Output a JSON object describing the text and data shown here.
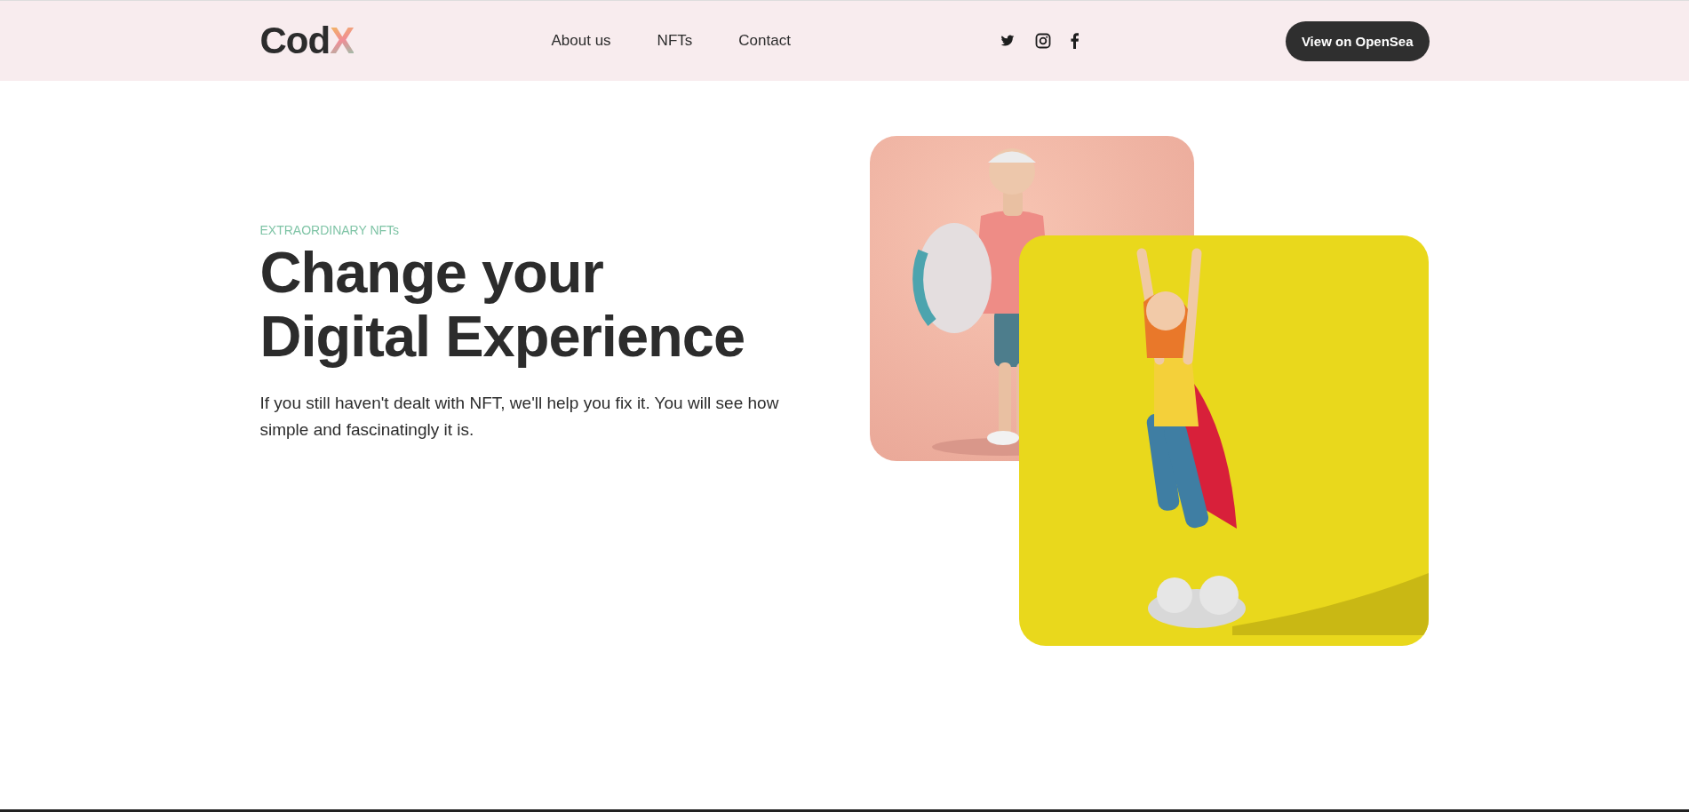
{
  "header": {
    "logo": {
      "main": "Cod",
      "accent": "X"
    },
    "nav": [
      {
        "label": "About us"
      },
      {
        "label": "NFTs"
      },
      {
        "label": "Contact"
      }
    ],
    "cta": "View on OpenSea"
  },
  "hero": {
    "eyebrow": "EXTRAORDINARY NFTs",
    "title_lines": [
      "Change your",
      "Digital Experience"
    ],
    "text": "If you still haven't dealt with NFT, we'll help you fix it. You will see how simple and fascinatingly it is."
  }
}
